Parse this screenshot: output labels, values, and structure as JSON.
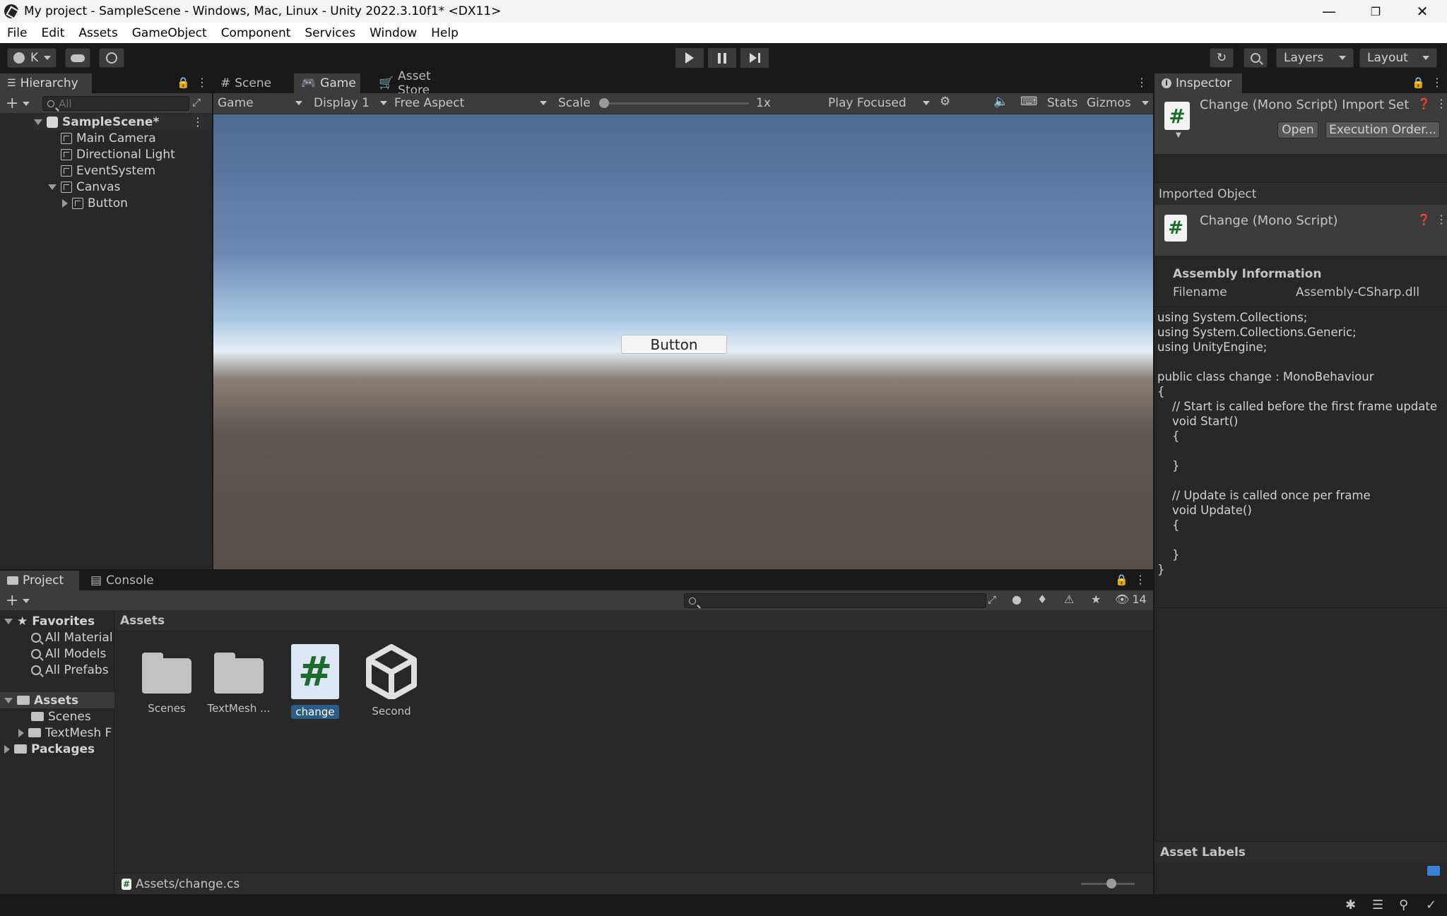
{
  "window": {
    "title": "My project - SampleScene - Windows, Mac, Linux - Unity 2022.3.10f1* <DX11>",
    "controls": [
      "minimize-icon",
      "restore-icon",
      "close-icon"
    ]
  },
  "menu": [
    "File",
    "Edit",
    "Assets",
    "GameObject",
    "Component",
    "Services",
    "Window",
    "Help"
  ],
  "toolbar": {
    "account": "K",
    "layers": "Layers",
    "layout": "Layout"
  },
  "hierarchy": {
    "tab": "Hierarchy",
    "search_placeholder": "All",
    "scene": "SampleScene*",
    "items": [
      "Main Camera",
      "Directional Light",
      "EventSystem",
      "Canvas",
      "Button"
    ]
  },
  "center_tabs": [
    "Scene",
    "Game",
    "Asset Store"
  ],
  "game_bar": {
    "view": "Game",
    "display": "Display 1",
    "aspect": "Free Aspect",
    "scale_label": "Scale",
    "scale_value": "1x",
    "play_mode": "Play Focused",
    "stats": "Stats",
    "gizmos": "Gizmos"
  },
  "game_view": {
    "button_label": "Button"
  },
  "inspector": {
    "tab": "Inspector",
    "header_title": "Change (Mono Script) Import Set",
    "open": "Open",
    "execution_order": "Execution Order...",
    "imported_object": "Imported Object",
    "script_title": "Change (Mono Script)",
    "assembly_info": "Assembly Information",
    "filename_label": "Filename",
    "filename_value": "Assembly-CSharp.dll",
    "code": "using System.Collections;\nusing System.Collections.Generic;\nusing UnityEngine;\n\npublic class change : MonoBehaviour\n{\n    // Start is called before the first frame update\n    void Start()\n    {\n        \n    }\n\n    // Update is called once per frame\n    void Update()\n    {\n        \n    }\n}",
    "asset_labels": "Asset Labels"
  },
  "project": {
    "tabs": [
      "Project",
      "Console"
    ],
    "hidden_count": "14",
    "favorites": "Favorites",
    "favorite_items": [
      "All Material",
      "All Models",
      "All Prefabs"
    ],
    "assets_root": "Assets",
    "asset_folders": [
      "Scenes",
      "TextMesh F"
    ],
    "packages": "Packages",
    "breadcrumb": "Assets",
    "grid_items": [
      "Scenes",
      "TextMesh ...",
      "change",
      "Second"
    ],
    "path": "Assets/change.cs"
  },
  "colors": {
    "accent_select": "#2c5d87",
    "panel": "#282828",
    "csharp_green": "#1e6b2e"
  }
}
